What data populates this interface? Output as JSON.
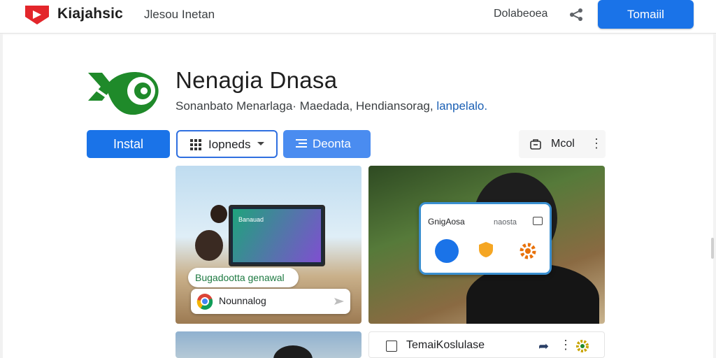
{
  "header": {
    "brand": "Kiajahsic",
    "subtitle": "Jlesou Inetan",
    "link": "Dolabeoea",
    "cta": "Tomaiil"
  },
  "app": {
    "title": "Nenagia Dnasa",
    "meta_text": "Sonanbato Menarlaga· Maedada, Hendiansorag,",
    "meta_link": "lanpelalo."
  },
  "actions": {
    "install": "Instal",
    "dropdown": "Iopneds",
    "demo": "Deonta",
    "more": "Mcol"
  },
  "cards": {
    "card1": {
      "tv_label": "Banauad",
      "pill_top": "Bugadootta genawal",
      "pill_bottom": "Nounnalog"
    },
    "card2": {
      "phone_title": "GnigAosa",
      "phone_sub": "naosta"
    },
    "card4": {
      "label": "TemaiKoslulase"
    }
  },
  "colors": {
    "primary": "#1a73e8",
    "brand_red": "#e3262b",
    "icon_green": "#1f8a2a"
  }
}
